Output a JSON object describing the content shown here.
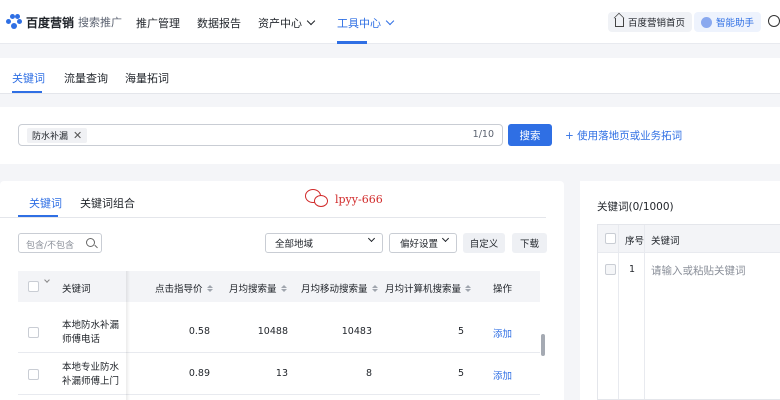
{
  "brand": {
    "name": "百度营销",
    "product": "搜索推广"
  },
  "nav": {
    "items": [
      {
        "label": "推广管理"
      },
      {
        "label": "数据报告"
      },
      {
        "label": "资产中心"
      },
      {
        "label": "工具中心"
      }
    ],
    "active": "工具中心",
    "home_link": "百度营销首页",
    "assistant": "智能助手"
  },
  "subtabs": {
    "items": [
      "关键词",
      "流量查询",
      "海量拓词"
    ],
    "active": "关键词"
  },
  "search": {
    "tag": "防水补漏",
    "counter": "1/10",
    "button": "搜索",
    "landing_link": "+ 使用落地页或业务拓词"
  },
  "result_tabs": {
    "items": [
      "关键词",
      "关键词组合"
    ],
    "active": "关键词"
  },
  "watermark": {
    "text": "lpyy-666"
  },
  "toolbar": {
    "filter_placeholder": "包含/不包含",
    "region": "全部地域",
    "preference": "偏好设置",
    "customize": "自定义",
    "download": "下载"
  },
  "table": {
    "columns": [
      "关键词",
      "点击指导价",
      "月均搜索量",
      "月均移动搜索量",
      "月均计算机搜索量",
      "操作"
    ],
    "rows": [
      {
        "keyword": "本地防水补漏师傅电话",
        "cpc": "0.58",
        "monthly": "10488",
        "mobile": "10483",
        "pc": "5",
        "action": "添加"
      },
      {
        "keyword": "本地专业防水补漏师傅上门",
        "cpc": "0.89",
        "monthly": "13",
        "mobile": "8",
        "pc": "5",
        "action": "添加"
      }
    ]
  },
  "side": {
    "title": "关键词(0/1000)",
    "columns": [
      "序号",
      "关键词"
    ],
    "row_index": "1",
    "input_placeholder": "请输入或粘贴关键词"
  },
  "colors": {
    "primary": "#2f6fe4",
    "watermark": "#d12a2a",
    "background": "#f4f5f8"
  }
}
